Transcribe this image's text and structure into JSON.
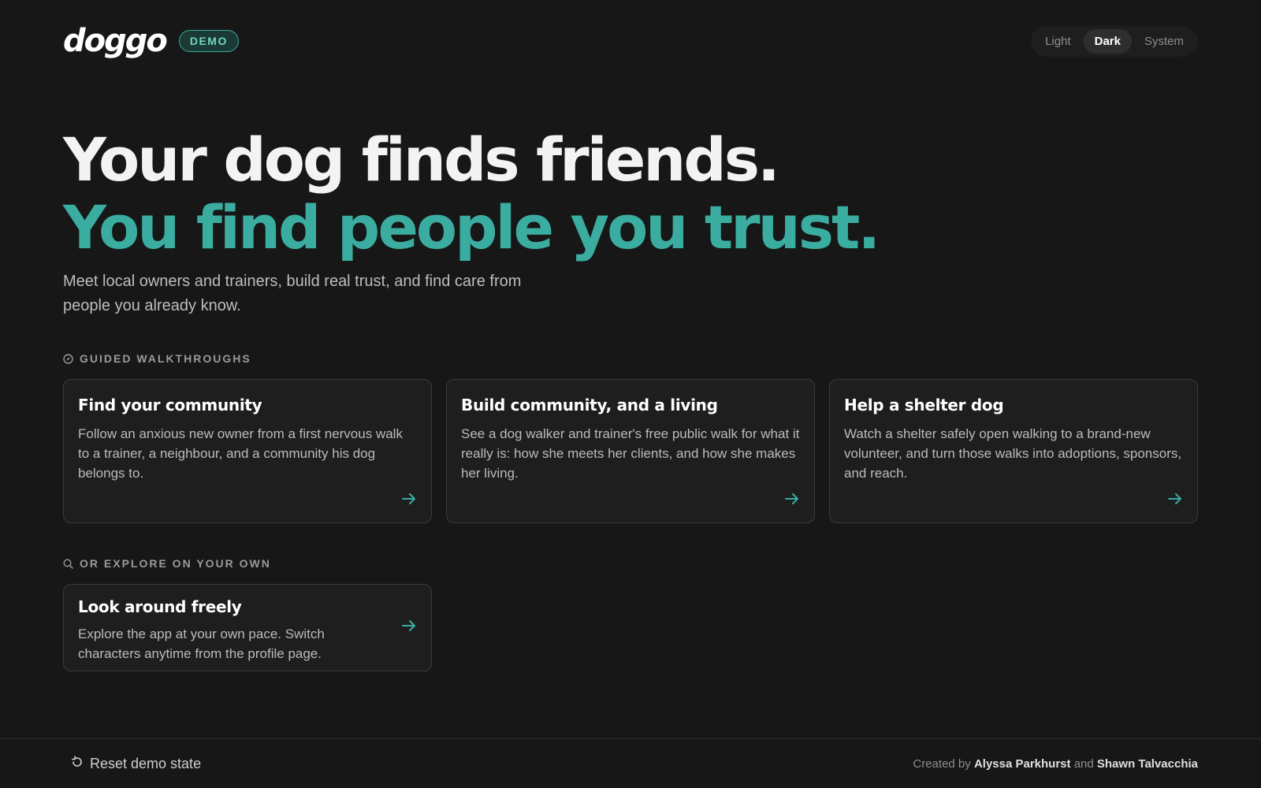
{
  "header": {
    "logo_text": "doggo",
    "badge": "DEMO",
    "theme_options": [
      "Light",
      "Dark",
      "System"
    ],
    "theme_selected": "Dark"
  },
  "hero": {
    "line1": "Your dog finds friends.",
    "line2": "You find people you trust.",
    "subtitle": "Meet local owners and trainers, build real trust, and find care from people you already know."
  },
  "guided": {
    "label": "GUIDED WALKTHROUGHS",
    "cards": [
      {
        "title": "Find your community",
        "desc": "Follow an anxious new owner from a first nervous walk to a trainer, a neighbour, and a community his dog belongs to."
      },
      {
        "title": "Build community, and a living",
        "desc": "See a dog walker and trainer's free public walk for what it really is: how she meets her clients, and how she makes her living."
      },
      {
        "title": "Help a shelter dog",
        "desc": "Watch a shelter safely open walking to a brand-new volunteer, and turn those walks into adoptions, sponsors, and reach."
      }
    ]
  },
  "explore": {
    "label": "OR EXPLORE ON YOUR OWN",
    "card": {
      "title": "Look around freely",
      "desc": "Explore the app at your own pace. Switch characters anytime from the profile page."
    }
  },
  "footer": {
    "reset_label": "Reset demo state",
    "created_by": "Created by",
    "author1": "Alyssa Parkhurst",
    "and": "and",
    "author2": "Shawn Talvacchia"
  },
  "colors": {
    "background": "#171717",
    "accent": "#3aada0",
    "card_bg": "#1e1e1e",
    "card_border": "#3a3a3a"
  },
  "icons": {
    "section_guided": "compass-icon",
    "section_explore": "search-icon",
    "card_arrow": "arrow-right-icon",
    "reset": "reset-icon"
  }
}
